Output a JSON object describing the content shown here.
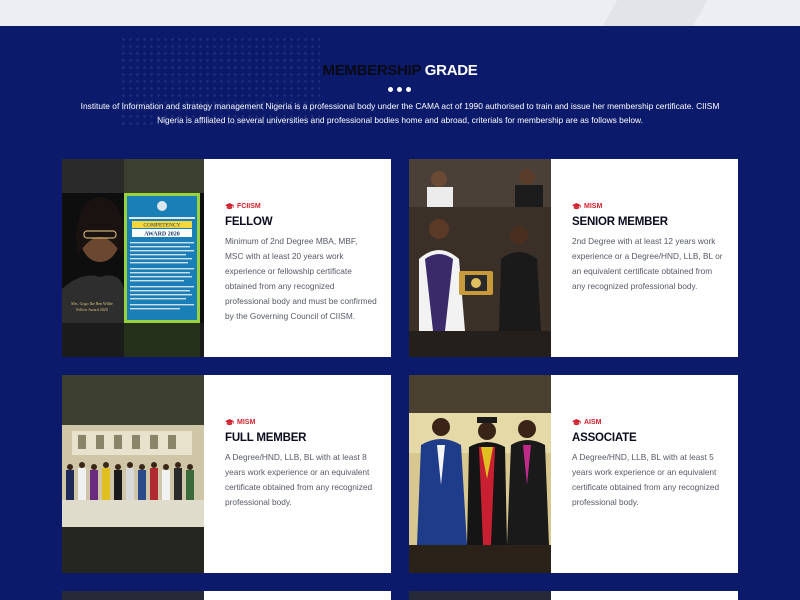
{
  "section": {
    "heading_part1": "MEMBERSHIP",
    "heading_part2": "GRADE",
    "intro": "Institute of Information and strategy management Nigeria is a professional body under the CAMA act of 1990 authorised to train and issue her membership certificate. CIISM Nigeria is affiliated to several universities and professional bodies home and abroad, criterials for membership are as follows below."
  },
  "cards": [
    {
      "badge": "FCIISM",
      "title": "FELLOW",
      "description": "Minimum of 2nd Degree MBA, MBF, MSC with at least 20 years work experience or fellowship certificate obtained from any recognized professional body and must be confirmed by the Governing Council of CIISM.",
      "poster": {
        "line1": "COMPETENCY",
        "line2": "AWARD 2020",
        "caption1": "Mrs. Gogo Ike Ben Willie",
        "caption2": "Fellow Award 2020"
      }
    },
    {
      "badge": "MISM",
      "title": "SENIOR MEMBER",
      "description": "2nd Degree with at least 12 years work experience or a Degree/HND, LLB, BL or an equivalent certificate obtained from any recognized professional body."
    },
    {
      "badge": "MISM",
      "title": "FULL MEMBER",
      "description": "A Degree/HND, LLB, BL with at least 8 years work experience or an equivalent certificate obtained from any recognized professional body."
    },
    {
      "badge": "AISM",
      "title": "ASSOCIATE",
      "description": "A Degree/HND, LLB, BL with at least 5 years work experience or an equivalent certificate obtained from any recognized professional body."
    }
  ],
  "colors": {
    "section_bg": "#0b1a6b",
    "badge_red": "#d3212c",
    "card_bg": "#ffffff",
    "title_dark": "#0b0b1e"
  },
  "icons": {
    "badge": "graduation-cap-icon"
  }
}
